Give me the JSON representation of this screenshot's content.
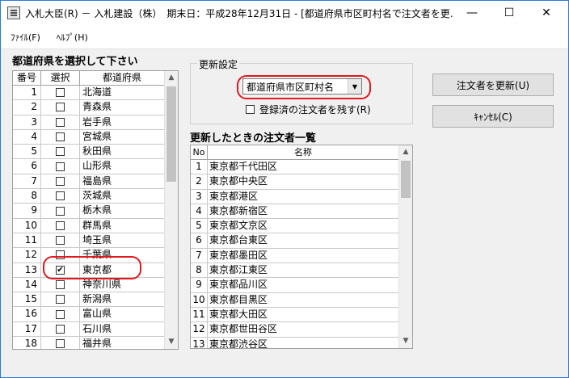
{
  "window": {
    "title": "入札大臣(R) － 入札建設（株）　期末日：平成28年12月31日 - [都道府県市区町村名で注文者を更…",
    "minimize": "—",
    "maximize": "☐",
    "close": "✕"
  },
  "menu": [
    {
      "label": "ﾌｧｲﾙ(F)"
    },
    {
      "label": "ﾍﾙﾌﾟ(H)"
    }
  ],
  "prefecture_panel": {
    "heading": "都道府県を選択して下さい",
    "columns": {
      "no": "番号",
      "select": "選択",
      "name": "都道府県"
    },
    "rows": [
      {
        "no": "1",
        "name": "北海道",
        "checked": false
      },
      {
        "no": "2",
        "name": "青森県",
        "checked": false
      },
      {
        "no": "3",
        "name": "岩手県",
        "checked": false
      },
      {
        "no": "4",
        "name": "宮城県",
        "checked": false
      },
      {
        "no": "5",
        "name": "秋田県",
        "checked": false
      },
      {
        "no": "6",
        "name": "山形県",
        "checked": false
      },
      {
        "no": "7",
        "name": "福島県",
        "checked": false
      },
      {
        "no": "8",
        "name": "茨城県",
        "checked": false
      },
      {
        "no": "9",
        "name": "栃木県",
        "checked": false
      },
      {
        "no": "10",
        "name": "群馬県",
        "checked": false
      },
      {
        "no": "11",
        "name": "埼玉県",
        "checked": false
      },
      {
        "no": "12",
        "name": "千葉県",
        "checked": false
      },
      {
        "no": "13",
        "name": "東京都",
        "checked": true
      },
      {
        "no": "14",
        "name": "神奈川県",
        "checked": false
      },
      {
        "no": "15",
        "name": "新潟県",
        "checked": false
      },
      {
        "no": "16",
        "name": "富山県",
        "checked": false
      },
      {
        "no": "17",
        "name": "石川県",
        "checked": false
      },
      {
        "no": "18",
        "name": "福井県",
        "checked": false
      }
    ]
  },
  "update_settings": {
    "legend": "更新設定",
    "combo_value": "都道府県市区町村名",
    "keep_checkbox_label": "登録済の注文者を残す(R)",
    "keep_checked": false
  },
  "customer_list": {
    "heading": "更新したときの注文者一覧",
    "columns": {
      "no": "No",
      "name": "名称"
    },
    "rows": [
      {
        "no": "1",
        "name": "東京都千代田区"
      },
      {
        "no": "2",
        "name": "東京都中央区"
      },
      {
        "no": "3",
        "name": "東京都港区"
      },
      {
        "no": "4",
        "name": "東京都新宿区"
      },
      {
        "no": "5",
        "name": "東京都文京区"
      },
      {
        "no": "6",
        "name": "東京都台東区"
      },
      {
        "no": "7",
        "name": "東京都墨田区"
      },
      {
        "no": "8",
        "name": "東京都江東区"
      },
      {
        "no": "9",
        "name": "東京都品川区"
      },
      {
        "no": "10",
        "name": "東京都目黒区"
      },
      {
        "no": "11",
        "name": "東京都大田区"
      },
      {
        "no": "12",
        "name": "東京都世田谷区"
      },
      {
        "no": "13",
        "name": "東京都渋谷区"
      }
    ]
  },
  "buttons": {
    "update": "注文者を更新(U)",
    "cancel": "ｷｬﾝｾﾙ(C)"
  },
  "colors": {
    "highlight": "#e0191f",
    "window_border": "#2b79d7"
  }
}
